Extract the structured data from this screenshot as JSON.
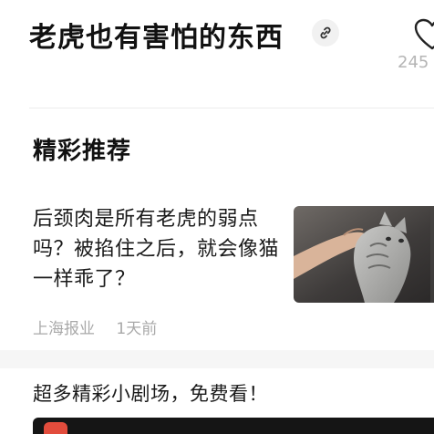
{
  "header": {
    "title": "老虎也有害怕的东西",
    "count": "245"
  },
  "section": {
    "title": "精彩推荐"
  },
  "article": {
    "title": "后颈肉是所有老虎的弱点吗？被掐住之后，就会像猫一样乖了？",
    "source": "上海报业",
    "time": "1天前"
  },
  "promo": {
    "text": "超多精彩小剧场，免费看！"
  },
  "icons": {
    "link": "link-icon",
    "like": "heart-icon"
  }
}
